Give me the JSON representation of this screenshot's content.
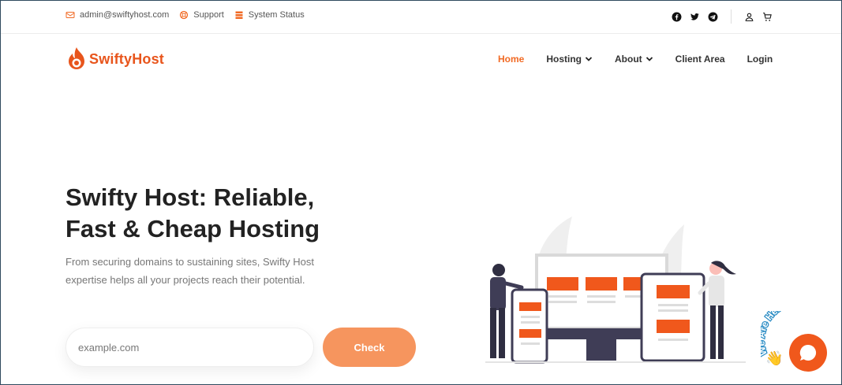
{
  "topbar": {
    "email": "admin@swiftyhost.com",
    "support": "Support",
    "system_status": "System Status"
  },
  "logo": {
    "text": "SwiftyHost"
  },
  "nav": {
    "items": [
      {
        "label": "Home"
      },
      {
        "label": "Hosting"
      },
      {
        "label": "About"
      },
      {
        "label": "Client Area"
      },
      {
        "label": "Login"
      }
    ]
  },
  "hero": {
    "title_line1": "Swifty Host: Reliable,",
    "title_line2": "Fast & Cheap Hosting",
    "description": "From securing domains to sustaining sites, Swifty Host expertise helps all your projects reach their potential.",
    "input_placeholder": "example.com",
    "check_label": "Check"
  },
  "chat_widget": {
    "tagline": "We Are Here!"
  },
  "colors": {
    "brand": "#f16a24",
    "button": "#f6955e",
    "chat": "#f0581c"
  }
}
